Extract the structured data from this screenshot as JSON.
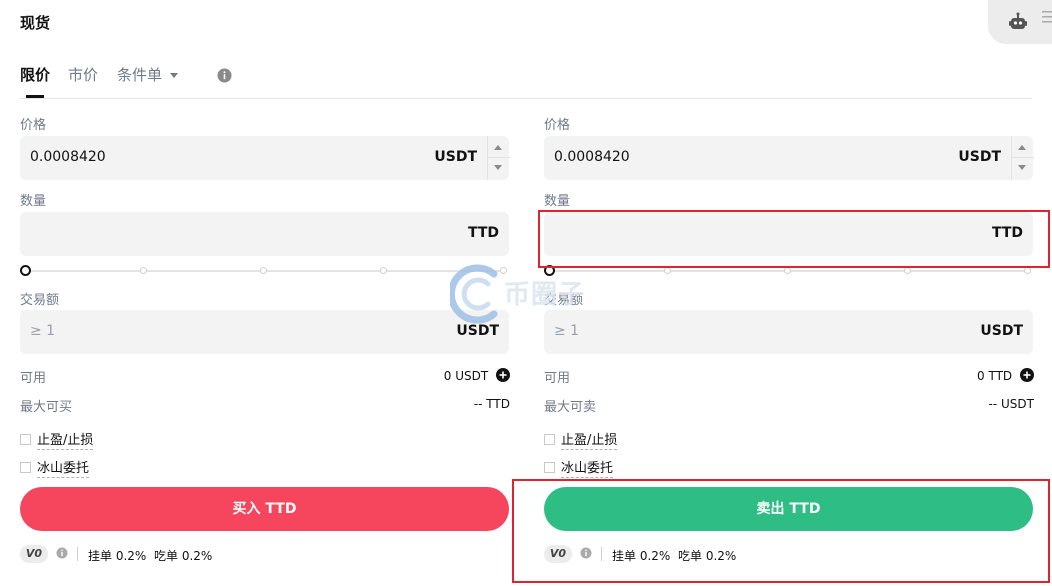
{
  "title": "现货",
  "tabs": [
    {
      "label": "限价",
      "active": true
    },
    {
      "label": "市价",
      "active": false
    },
    {
      "label": "条件单",
      "active": false
    }
  ],
  "icons": {
    "bot": "robot-icon",
    "menu": "menu-icon",
    "info": "info-icon",
    "plus": "plus-circle-icon"
  },
  "colors": {
    "buy": "#f6465d",
    "sell": "#2ebd85",
    "highlight": "#e0242f"
  },
  "buy": {
    "price_label": "价格",
    "price_value": "0.0008420",
    "price_unit": "USDT",
    "amount_label": "数量",
    "amount_value": "",
    "amount_unit": "TTD",
    "slider_percent": 0,
    "total_label": "交易额",
    "total_placeholder": "≥ 1",
    "total_unit": "USDT",
    "available_label": "可用",
    "available_value": "0 USDT",
    "max_label": "最大可买",
    "max_value": "-- TTD",
    "tpsl_label": "止盈/止损",
    "iceberg_label": "冰山委托",
    "button_label": "买入 TTD",
    "vip": "V0",
    "maker_fee": "挂单 0.2%",
    "taker_fee": "吃单 0.2%"
  },
  "sell": {
    "price_label": "价格",
    "price_value": "0.0008420",
    "price_unit": "USDT",
    "amount_label": "数量",
    "amount_value": "",
    "amount_unit": "TTD",
    "slider_percent": 0,
    "total_label": "交易额",
    "total_placeholder": "≥ 1",
    "total_unit": "USDT",
    "available_label": "可用",
    "available_value": "0 TTD",
    "max_label": "最大可卖",
    "max_value": "-- USDT",
    "tpsl_label": "止盈/止损",
    "iceberg_label": "冰山委托",
    "button_label": "卖出 TTD",
    "vip": "V0",
    "maker_fee": "挂单 0.2%",
    "taker_fee": "吃单 0.2%"
  },
  "watermark": "币圈子"
}
